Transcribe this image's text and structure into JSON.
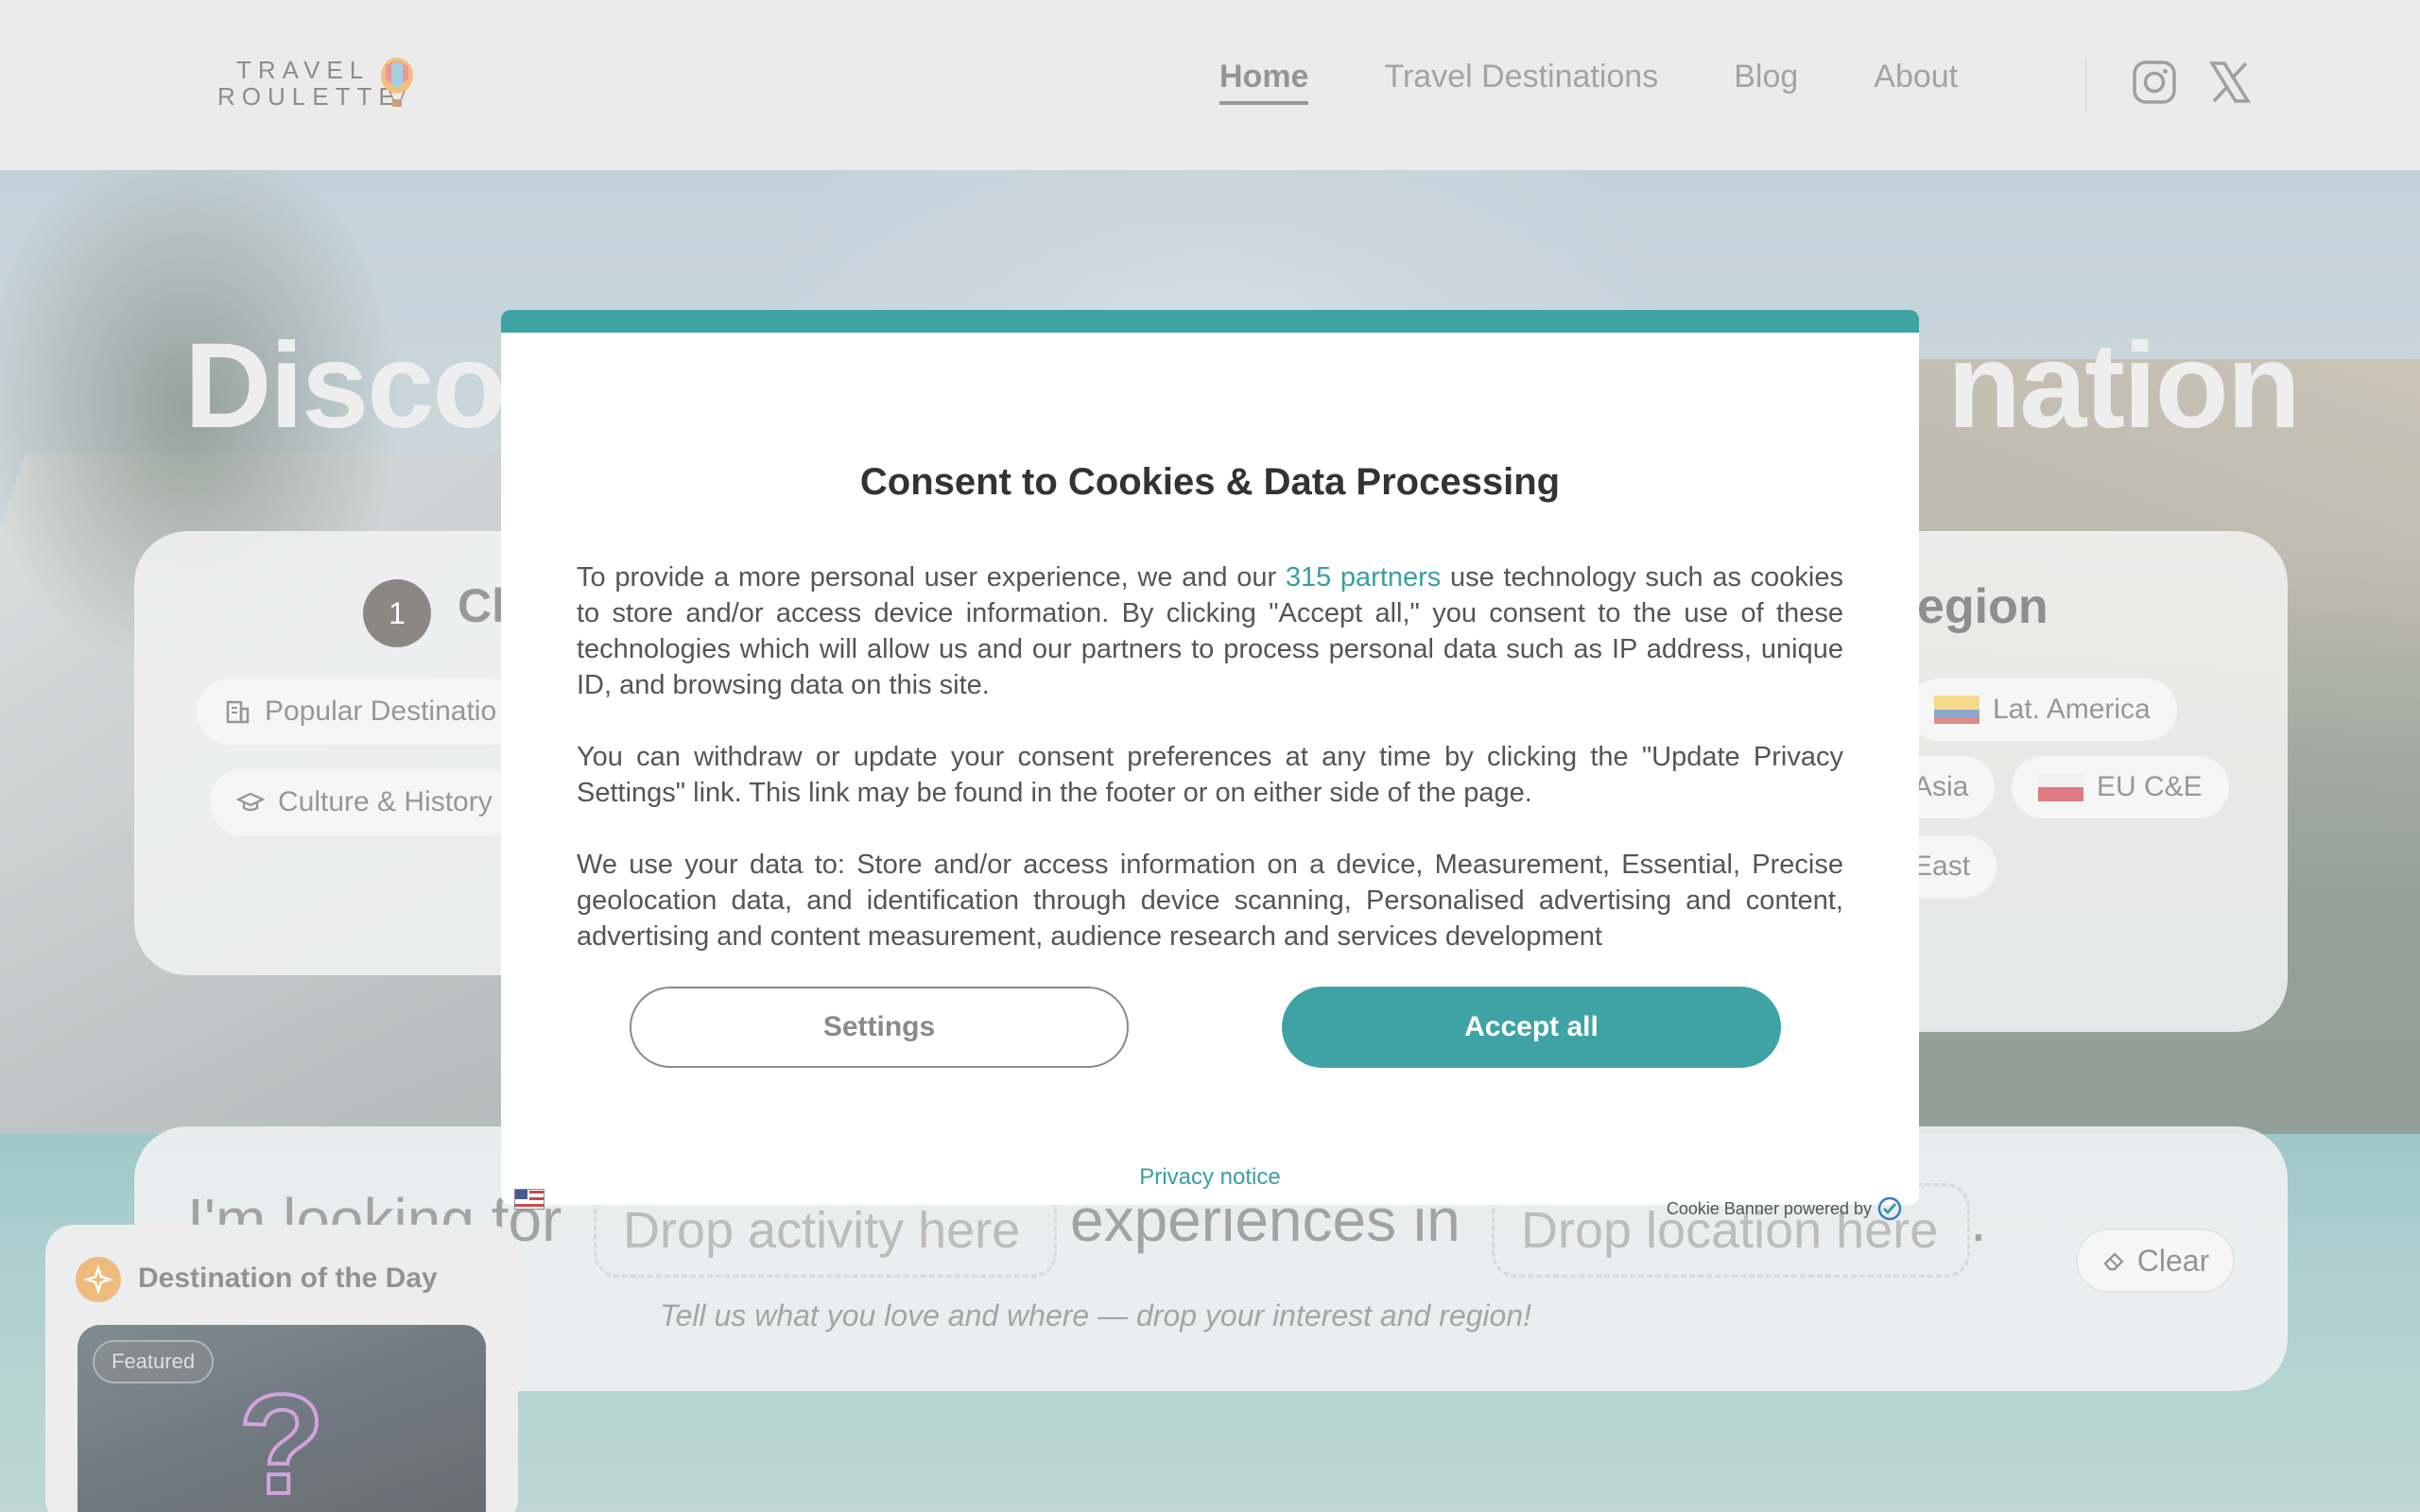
{
  "header": {
    "logo_line1": "TRAVEL",
    "logo_line2": "ROULETTE",
    "nav": [
      {
        "label": "Home",
        "active": true
      },
      {
        "label": "Travel Destinations",
        "active": false
      },
      {
        "label": "Blog",
        "active": false
      },
      {
        "label": "About",
        "active": false
      }
    ],
    "social": [
      "instagram-icon",
      "x-twitter-icon"
    ]
  },
  "hero": {
    "title_left": "Disco",
    "title_right": "nation"
  },
  "categories_panel": {
    "step_number": "1",
    "step_title_partial": "Cl",
    "chips": [
      "Popular Destinatio",
      "Culture & History"
    ]
  },
  "region_panel": {
    "title_partial": "egion",
    "chips": [
      {
        "label": "Lat. America",
        "flag": "latin-america-flag"
      },
      {
        "label": "Asia",
        "flag": ""
      },
      {
        "label": "EU C&E",
        "flag": "eu-ce-flag"
      },
      {
        "label": "East",
        "flag": ""
      }
    ]
  },
  "builder": {
    "prefix": "I'm looking for",
    "activity_placeholder": "Drop activity here",
    "middle": "experiences in",
    "location_placeholder": "Drop location here",
    "suffix": ".",
    "clear_label": "Clear",
    "hint": "Tell us what you love and where — drop your interest and region!"
  },
  "destination_of_day": {
    "title": "Destination of the Day",
    "badge": "Featured",
    "mystery_glyph": "?"
  },
  "cookie_modal": {
    "title": "Consent to Cookies & Data Processing",
    "para1_before_link": "To provide a more personal user experience, we and our ",
    "para1_link": "315 partners",
    "para1_after_link": " use technology such as cookies to store and/or access device information. By clicking \"Accept all,\" you consent to the use of these technologies which will allow us and our partners to process personal data such as IP address, unique ID, and browsing data on this site.",
    "para2": "You can withdraw or update your consent preferences at any time by clicking the \"Update Privacy Settings\" link. This link may be found in the footer or on either side of the page.",
    "para3": "We use your data to: Store and/or access information on a device, Measurement, Essential, Precise geolocation data, and identification through device scanning, Personalised advertising and content, advertising and content measurement, audience research and services development",
    "settings_label": "Settings",
    "accept_label": "Accept all",
    "privacy_label": "Privacy notice",
    "powered_by": "Cookie Banner powered by"
  },
  "colors": {
    "accent": "#3fa3a6",
    "header_bg": "#e6e6e6"
  }
}
